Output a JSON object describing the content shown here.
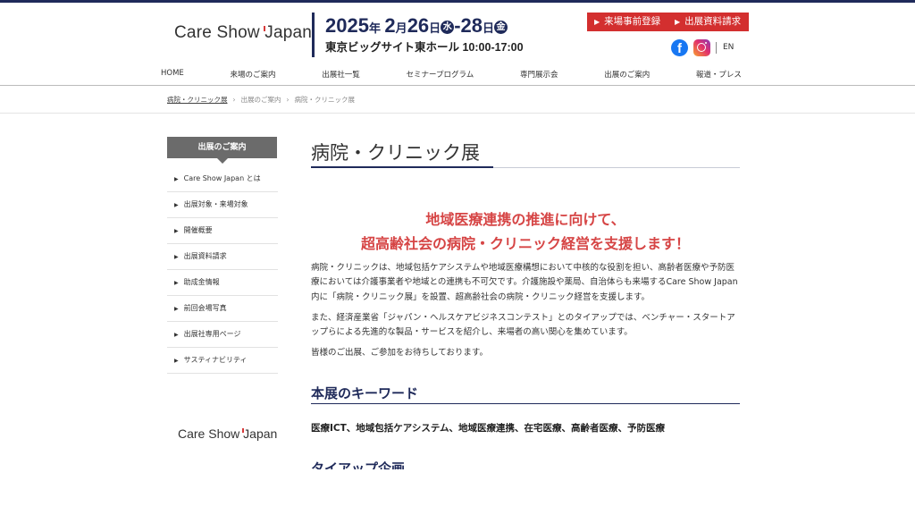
{
  "header": {
    "logo_pre": "Care Show ",
    "logo_j": "J",
    "logo_post": "apan",
    "date_year": "2025",
    "date_nen": "年",
    "date_month": "2",
    "date_tsuki": "月",
    "date_day1": "26",
    "date_nichi1": "日",
    "dow1": "水",
    "date_dash": "-",
    "date_day2": "28",
    "date_nichi2": "日",
    "dow2": "金",
    "venue": "東京ビッグサイト東ホール  10:00-17:00",
    "btn_register": "来場事前登録",
    "btn_documents": "出展資料請求",
    "facebook_icon": "facebook-icon",
    "instagram_icon": "instagram-icon",
    "lang": "EN"
  },
  "nav": [
    "HOME",
    "来場のご案内",
    "出展社一覧",
    "セミナープログラム",
    "専門展示会",
    "出展のご案内",
    "報道・プレス"
  ],
  "breadcrumb": [
    "病院・クリニック展",
    "出展のご案内",
    "病院・クリニック展"
  ],
  "sidebar": {
    "heading": "出展のご案内",
    "items": [
      "Care Show Japan とは",
      "出展対象・来場対象",
      "開催概要",
      "出展資料請求",
      "助成金情報",
      "前回会場写真",
      "出展社専用ページ",
      "サスティナビリティ"
    ],
    "logo_pre": "Care Show ",
    "logo_j": "J",
    "logo_post": "apan"
  },
  "main": {
    "title": "病院・クリニック展",
    "lead_line1": "地域医療連携の推進に向けて、",
    "lead_line2": "超高齢社会の病院・クリニック経営を支援します！",
    "paragraphs": [
      "病院・クリニックは、地域包括ケアシステムや地域医療構想において中核的な役割を担い、高齢者医療や予防医療においては介護事業者や地域との連携も不可欠です。介護施設や薬局、自治体らも来場するCare Show Japan内に「病院・クリニック展」を設置、超高齢社会の病院・クリニック経営を支援します。",
      "また、経済産業省「ジャパン・ヘルスケアビジネスコンテスト」とのタイアップでは、ベンチャー・スタートアップらによる先進的な製品・サービスを紹介し、来場者の高い関心を集めています。",
      "皆様のご出展、ご参加をお待ちしております。"
    ],
    "keywords_heading": "本展のキーワード",
    "keywords": "医療ICT、地域包括ケアシステム、地域医療連携、在宅医療、高齢者医療、予防医療",
    "tieup_heading": "タイアップ企画"
  },
  "colors": {
    "navy": "#1f2a5a",
    "red": "#d32f2f",
    "lead_red": "#d64545"
  }
}
